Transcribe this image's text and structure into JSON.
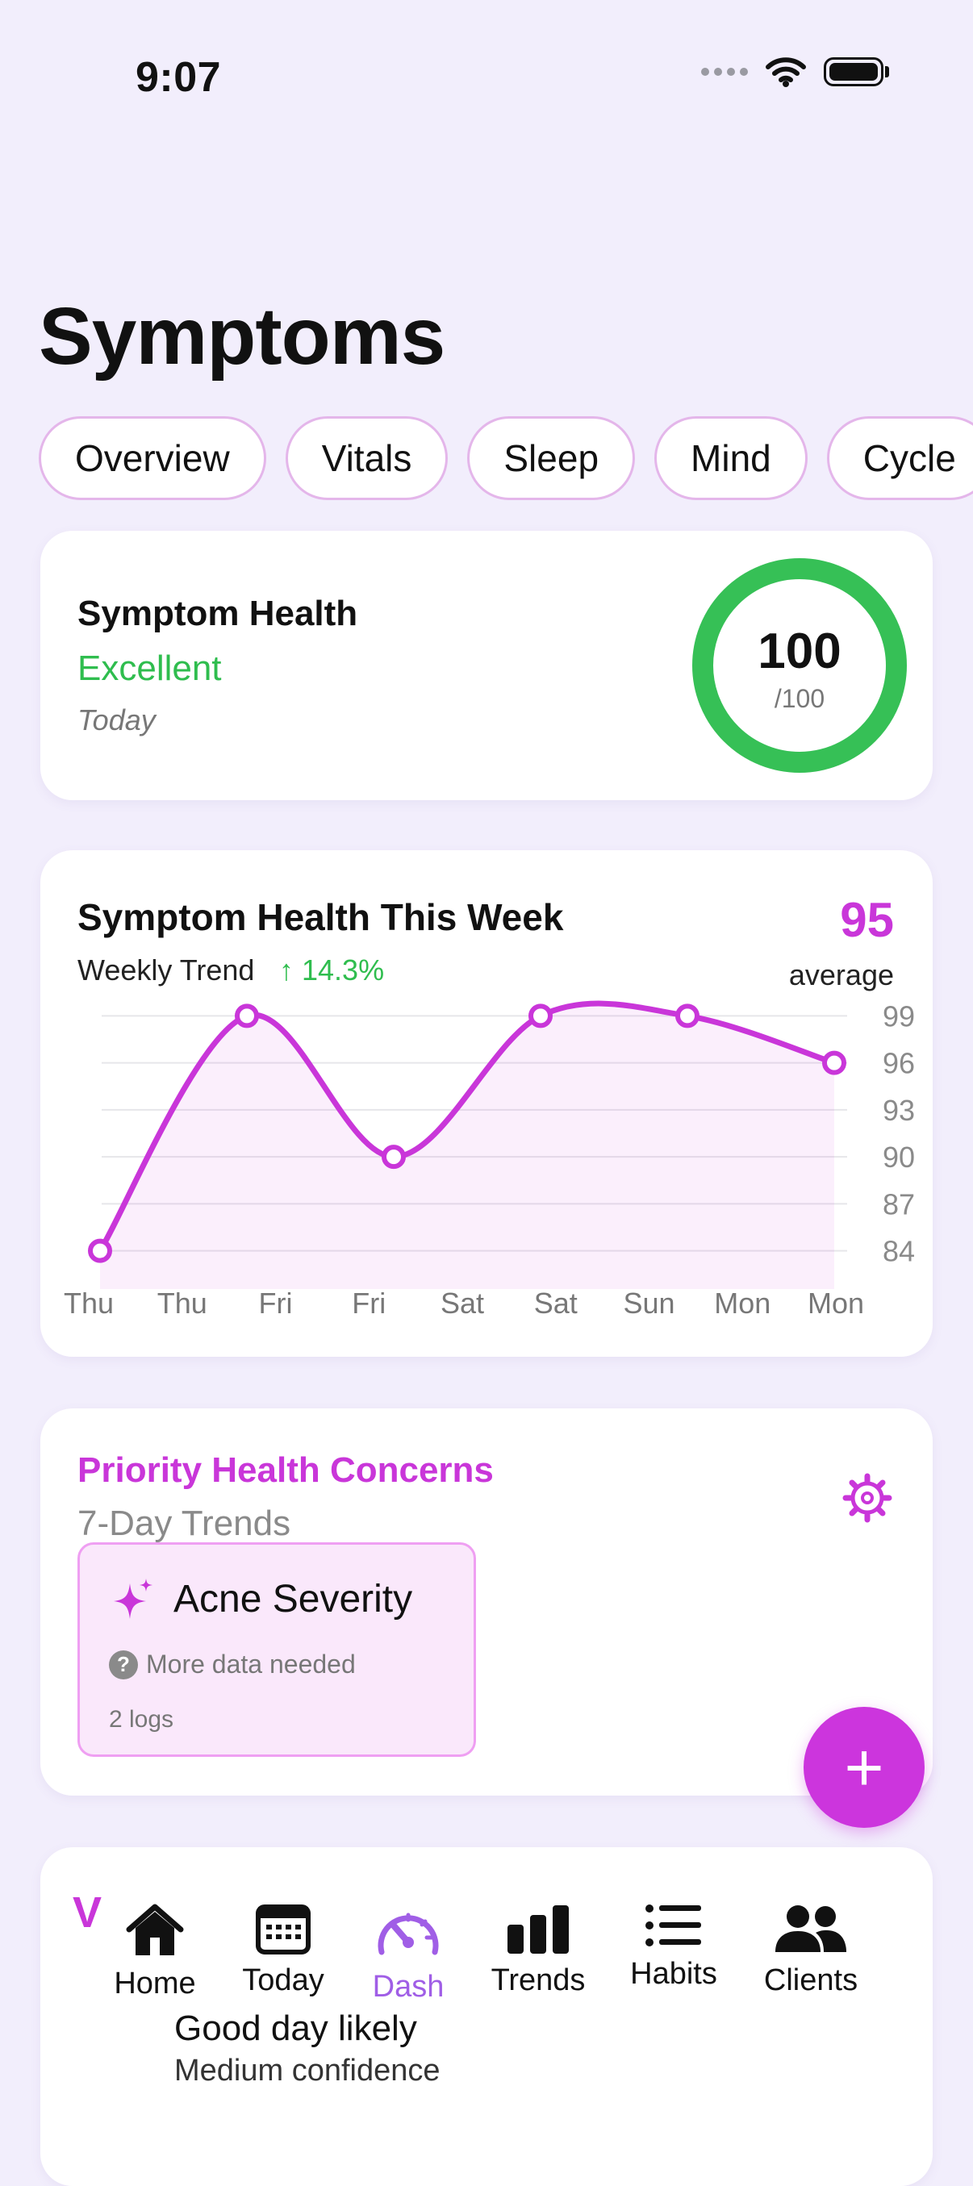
{
  "status_bar": {
    "time": "9:07"
  },
  "header": {
    "title": "Symptoms"
  },
  "tabs": [
    {
      "label": "Overview"
    },
    {
      "label": "Vitals"
    },
    {
      "label": "Sleep"
    },
    {
      "label": "Mind"
    },
    {
      "label": "Cycle"
    }
  ],
  "health_card": {
    "title": "Symptom Health",
    "status": "Excellent",
    "date": "Today",
    "score": "100",
    "score_max": "/100",
    "score_value": 100,
    "status_color": "#2fbd4e"
  },
  "weekly_card": {
    "title": "Symptom Health This Week",
    "subtitle": "Weekly Trend",
    "trend": "↑ 14.3%",
    "average": "95",
    "average_label": "average",
    "chart_data": {
      "type": "line",
      "x": [
        "Thu",
        "Thu",
        "Fri",
        "Fri",
        "Sat",
        "Sat",
        "Sun",
        "Mon",
        "Mon"
      ],
      "series": [
        {
          "values": [
            84,
            99,
            90,
            99,
            99,
            96
          ]
        }
      ],
      "y_ticks": [
        99,
        96,
        93,
        90,
        87,
        84
      ],
      "ylim": [
        83,
        100
      ],
      "grid": true,
      "color": "#c936d9"
    }
  },
  "priority_card": {
    "title": "Priority Health Concerns",
    "subtitle": "7-Day Trends",
    "concern": {
      "name": "Acne Severity",
      "status": "More data needed",
      "logs": "2 logs"
    }
  },
  "fab": {
    "label": "+"
  },
  "bottom_card": {
    "partial_letter": "V",
    "headline": "Good day likely",
    "confidence": "Medium confidence"
  },
  "tab_bar": {
    "items": [
      {
        "label": "Home",
        "icon": "home-icon"
      },
      {
        "label": "Today",
        "icon": "calendar-icon"
      },
      {
        "label": "Dash",
        "icon": "gauge-icon"
      },
      {
        "label": "Trends",
        "icon": "bar-chart-icon"
      },
      {
        "label": "Habits",
        "icon": "list-icon"
      },
      {
        "label": "Clients",
        "icon": "users-icon"
      }
    ],
    "active": "Dash",
    "active_color": "#a05ee6"
  }
}
